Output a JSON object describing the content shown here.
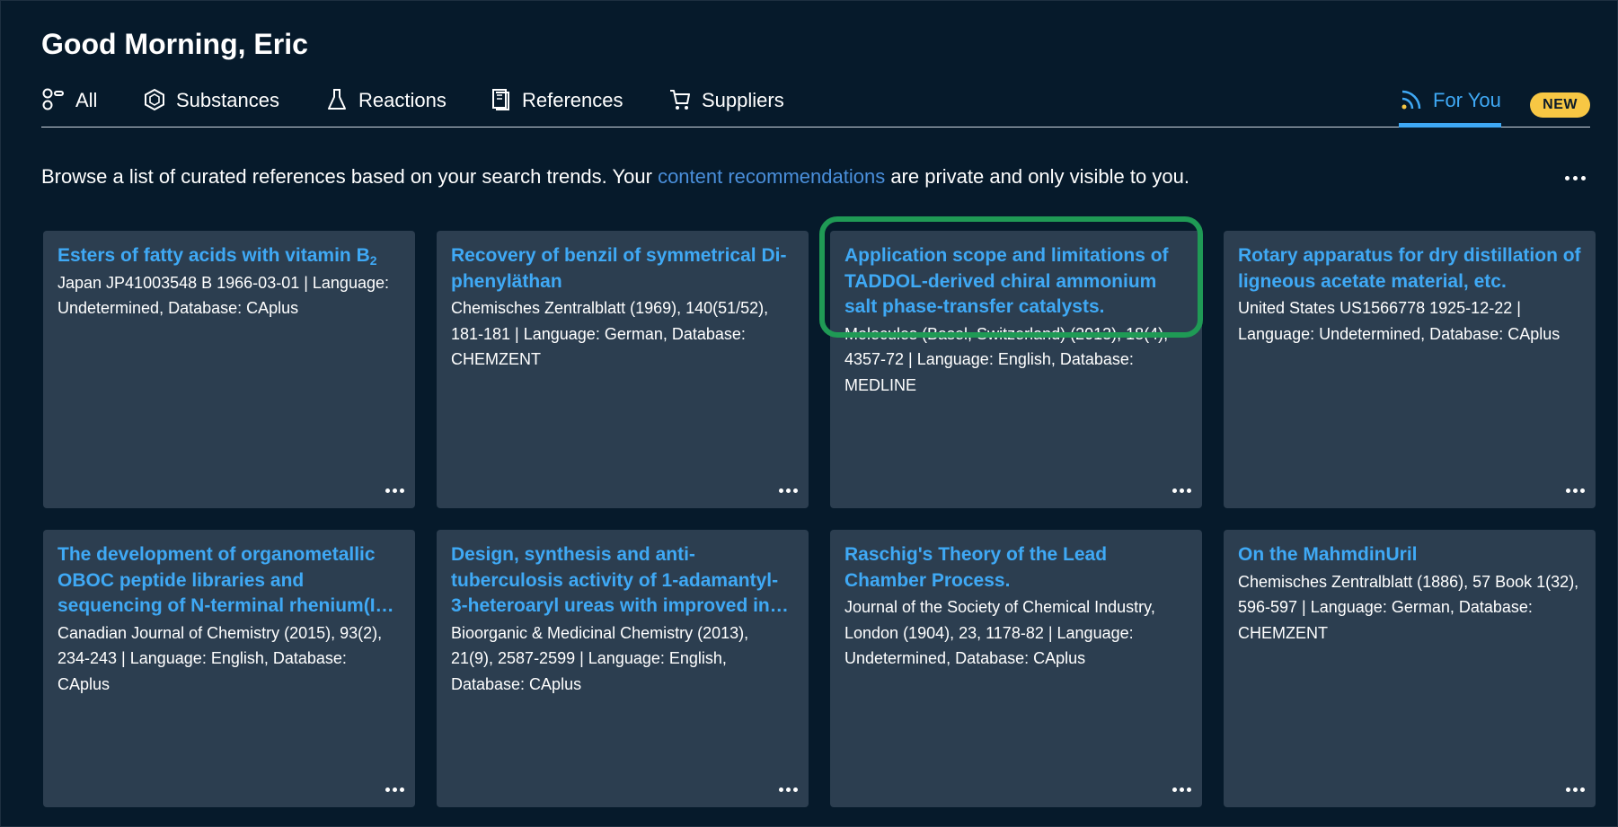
{
  "header": {
    "greeting": "Good Morning, Eric"
  },
  "tabs": [
    {
      "label": "All",
      "icon": "all-icon"
    },
    {
      "label": "Substances",
      "icon": "substance-icon"
    },
    {
      "label": "Reactions",
      "icon": "flask-icon"
    },
    {
      "label": "References",
      "icon": "document-icon"
    },
    {
      "label": "Suppliers",
      "icon": "cart-icon"
    },
    {
      "label": "For You",
      "icon": "rss-icon",
      "active": true
    }
  ],
  "badge": {
    "label": "NEW"
  },
  "intro": {
    "before": "Browse a list of curated references based on your search trends. Your ",
    "link": "content recommendations",
    "after": " are private and only visible to you."
  },
  "cards": [
    {
      "title": "Esters of fatty acids with vitamin B",
      "title_sub": "2",
      "meta": "Japan JP41003548 B 1966-03-01 | Language: Undetermined, Database: CAplus"
    },
    {
      "title": "Recovery of benzil of symmetrical Di-phenyläthan",
      "meta": "Chemisches Zentralblatt (1969), 140(51/52), 181-181 | Language: German, Database: CHEMZENT"
    },
    {
      "title": "Application scope and limitations of TADDOL-derived chiral ammonium salt phase-transfer catalysts.",
      "meta": "Molecules (Basel, Switzerland) (2013), 18(4), 4357-72 | Language: English, Database: MEDLINE"
    },
    {
      "title": "Rotary apparatus for dry distillation of ligneous acetate material, etc.",
      "meta": "United States US1566778 1925-12-22 | Language: Undetermined, Database: CAplus"
    },
    {
      "title": "The development of organometallic OBOC peptide libraries and sequencing of N-terminal rhenium(I…",
      "meta": "Canadian Journal of Chemistry (2015), 93(2), 234-243 | Language: English, Database: CAplus"
    },
    {
      "title": "Design, synthesis and anti-tuberculosis activity of 1-adamantyl-3-heteroaryl ureas with improved in…",
      "meta": "Bioorganic & Medicinal Chemistry (2013), 21(9), 2587-2599 | Language: English, Database: CAplus"
    },
    {
      "title": "Raschig's Theory of the Lead Chamber Process.",
      "meta": "Journal of the Society of Chemical Industry, London (1904), 23, 1178-82 | Language: Undetermined, Database: CAplus"
    },
    {
      "title": "On the MahmdinUril",
      "meta": "Chemisches Zentralblatt (1886), 57 Book 1(32), 596-597 | Language: German, Database: CHEMZENT"
    }
  ],
  "colors": {
    "background": "#061a2b",
    "card": "#2c3e50",
    "accent": "#3fa9f5",
    "link": "#4a8fdb",
    "badge": "#f7c744",
    "highlight": "#1f9a55"
  }
}
